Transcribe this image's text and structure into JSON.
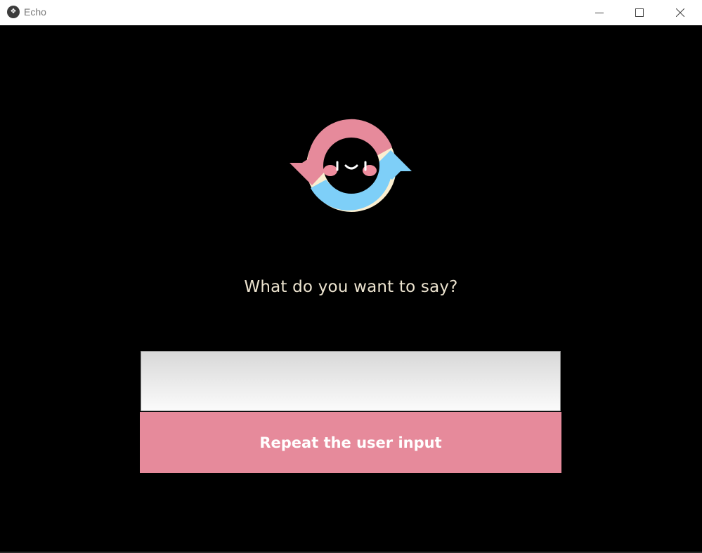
{
  "window": {
    "title": "Echo",
    "app_icon": "kivy-logo-icon",
    "controls": [
      "minimize-icon",
      "maximize-icon",
      "close-icon"
    ]
  },
  "logo": {
    "icon": "echo-cycle-logo-icon",
    "colors": {
      "pink": "#e68a9b",
      "cream": "#fbefd1",
      "peach": "#f5d6b6",
      "blue": "#7ecff8",
      "cheek": "#ee8c9d"
    }
  },
  "main": {
    "prompt": "What do you want to say?",
    "input_value": "",
    "button_label": "Repeat the user input"
  },
  "colors": {
    "background": "#000000",
    "prompt_text": "#ece3cf",
    "button": "#e68a9b",
    "button_text": "#ffffff"
  }
}
